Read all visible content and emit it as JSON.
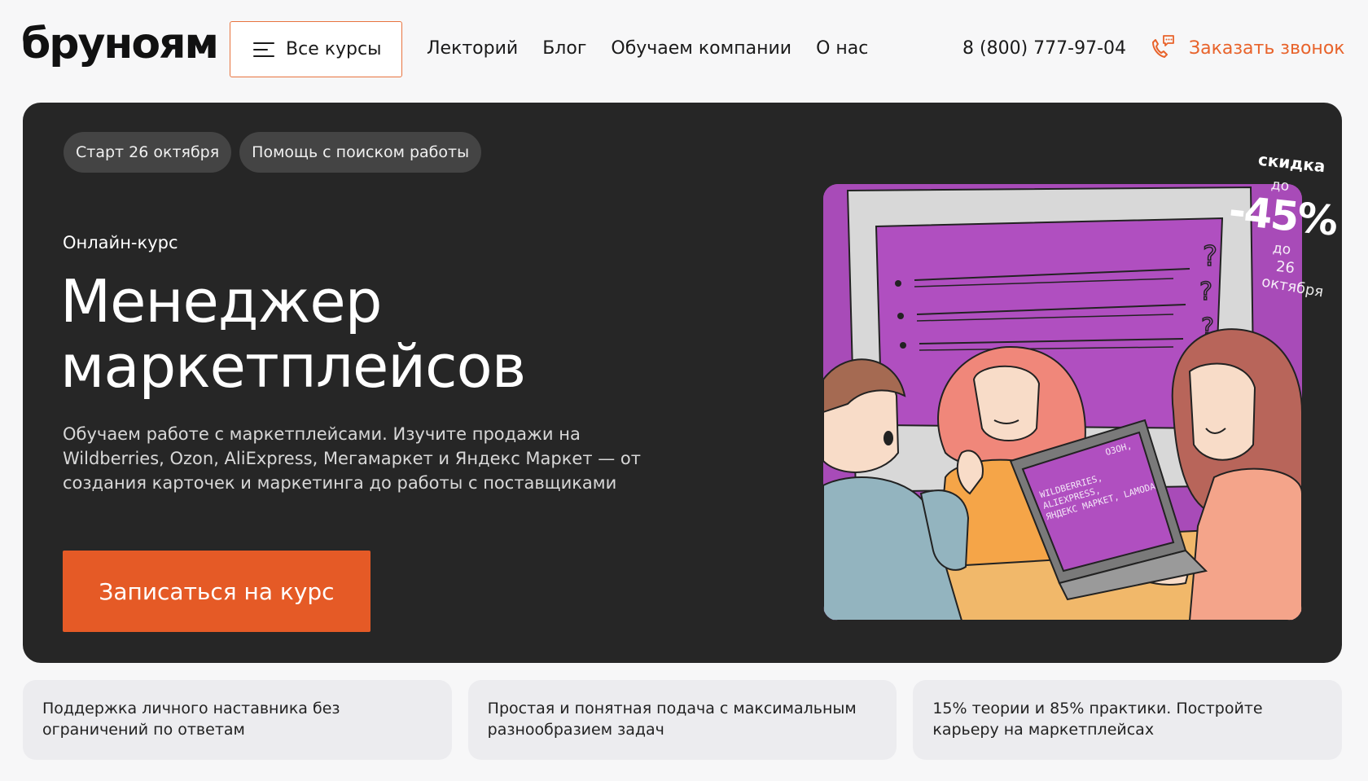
{
  "header": {
    "logo": "бруноям",
    "all_courses_label": "Все курсы",
    "nav": [
      "Лекторий",
      "Блог",
      "Обучаем компании",
      "О нас"
    ],
    "phone": "8 (800) 777-97-04",
    "callback_label": "Заказать звонок"
  },
  "hero": {
    "tags": [
      "Старт 26 октября",
      "Помощь с поиском работы"
    ],
    "course_type": "Онлайн-курс",
    "title_line1": "Менеджер",
    "title_line2": "маркетплейсов",
    "description": "Обучаем работе с маркетплейсами. Изучите продажи на Wildberries, Ozon, AliExpress, Мегамаркет и Яндекс Маркет — от создания карточек и маркетинга до работы с поставщиками",
    "cta_label": "Записаться на курс",
    "discount": {
      "line1": "скидка",
      "line2": "до",
      "percent": "-45%",
      "line3": "до",
      "line4": "26",
      "line5": "октября"
    },
    "laptop_text": [
      "ОЗОН,",
      "WILDBERRIES,",
      "ALIEXPRESS,",
      "ЯНДЕКС МАРКЕТ, LAMODA"
    ]
  },
  "features": [
    "Поддержка личного наставника без ограничений по ответам",
    "Простая и понятная подача с максимальным разнообразием задач",
    "15% теории и 85% практики. Постройте карьеру на маркетплейсах"
  ],
  "colors": {
    "accent": "#e55a26",
    "hero_bg": "#262626",
    "illustration_bg": "#a84bb8",
    "page_bg": "#f7f7f8"
  }
}
